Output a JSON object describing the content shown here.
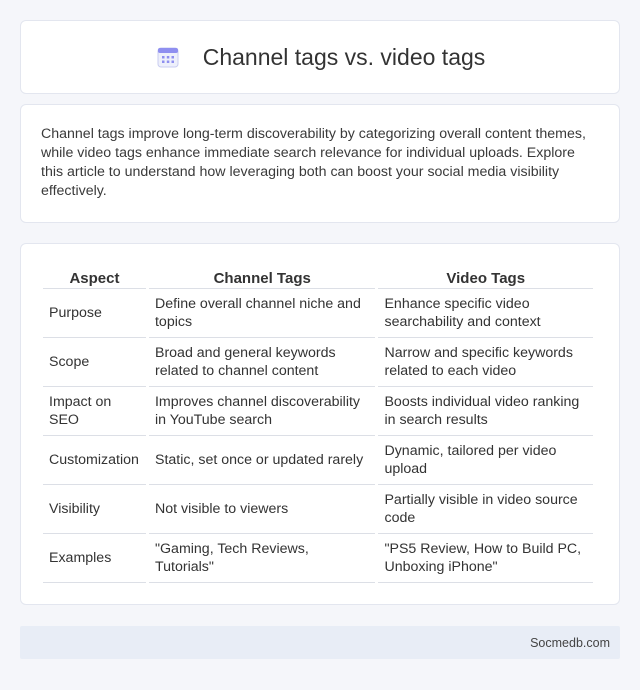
{
  "header": {
    "title": "Channel tags vs. video tags",
    "icon": "calendar-icon"
  },
  "intro": {
    "text": "Channel tags improve long-term discoverability by categorizing overall content themes, while video tags enhance immediate search relevance for individual uploads. Explore this article to understand how leveraging both can boost your social media visibility effectively."
  },
  "table": {
    "headers": [
      "Aspect",
      "Channel Tags",
      "Video Tags"
    ],
    "rows": [
      [
        "Purpose",
        "Define overall channel niche and topics",
        "Enhance specific video searchability and context"
      ],
      [
        "Scope",
        "Broad and general keywords related to channel content",
        "Narrow and specific keywords related to each video"
      ],
      [
        "Impact on SEO",
        "Improves channel discoverability in YouTube search",
        "Boosts individual video ranking in search results"
      ],
      [
        "Customization",
        "Static, set once or updated rarely",
        "Dynamic, tailored per video upload"
      ],
      [
        "Visibility",
        "Not visible to viewers",
        "Partially visible in video source code"
      ],
      [
        "Examples",
        "\"Gaming, Tech Reviews, Tutorials\"",
        "\"PS5 Review, How to Build PC, Unboxing iPhone\""
      ]
    ]
  },
  "footer": {
    "text": "Socmedb.com"
  }
}
